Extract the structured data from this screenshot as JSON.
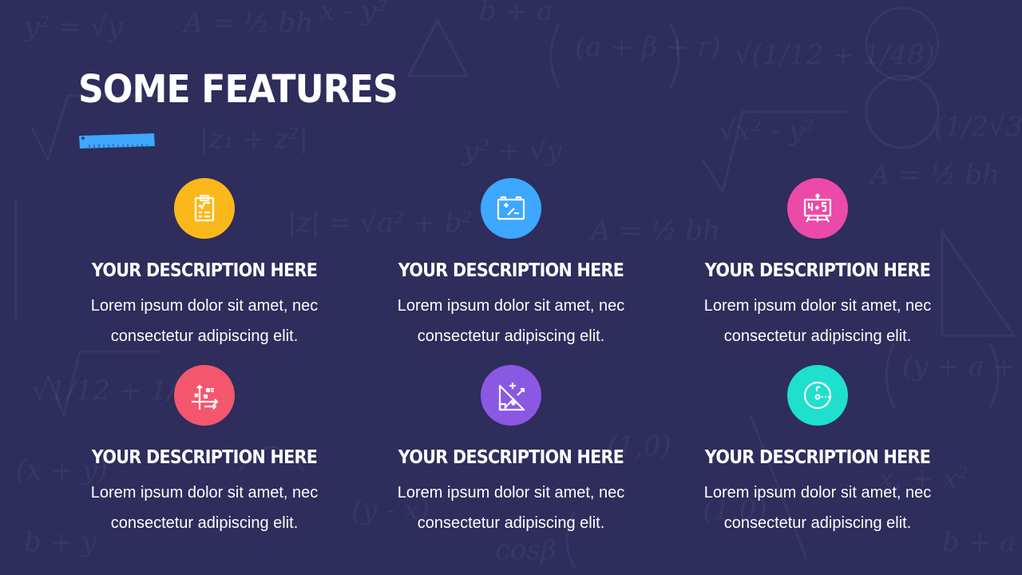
{
  "slide": {
    "title": "SOME FEATURES",
    "background_color": "#2e2d5c"
  },
  "features": [
    {
      "title": "YOUR DESCRIPTION HERE",
      "description": "Lorem ipsum dolor sit amet, nec consectetur adipiscing elit.",
      "icon": "clipboard-icon",
      "color": "#fbb81b"
    },
    {
      "title": "YOUR DESCRIPTION HERE",
      "description": "Lorem ipsum dolor sit amet, nec consectetur adipiscing elit.",
      "icon": "calculator-battery-icon",
      "color": "#3ea7ff"
    },
    {
      "title": "YOUR DESCRIPTION HERE",
      "description": "Lorem ipsum dolor sit amet, nec consectetur adipiscing elit.",
      "icon": "blackboard-icon",
      "color": "#ec4aa8"
    },
    {
      "title": "YOUR DESCRIPTION HERE",
      "description": "Lorem ipsum dolor sit amet, nec consectetur adipiscing elit.",
      "icon": "graph-axes-icon",
      "color": "#f4566e"
    },
    {
      "title": "YOUR DESCRIPTION HERE",
      "description": "Lorem ipsum dolor sit amet, nec consectetur adipiscing elit.",
      "icon": "set-square-icon",
      "color": "#8a58e3"
    },
    {
      "title": "YOUR DESCRIPTION HERE",
      "description": "Lorem ipsum dolor sit amet, nec consectetur adipiscing elit.",
      "icon": "circle-radius-icon",
      "color": "#1fdfcd"
    }
  ]
}
